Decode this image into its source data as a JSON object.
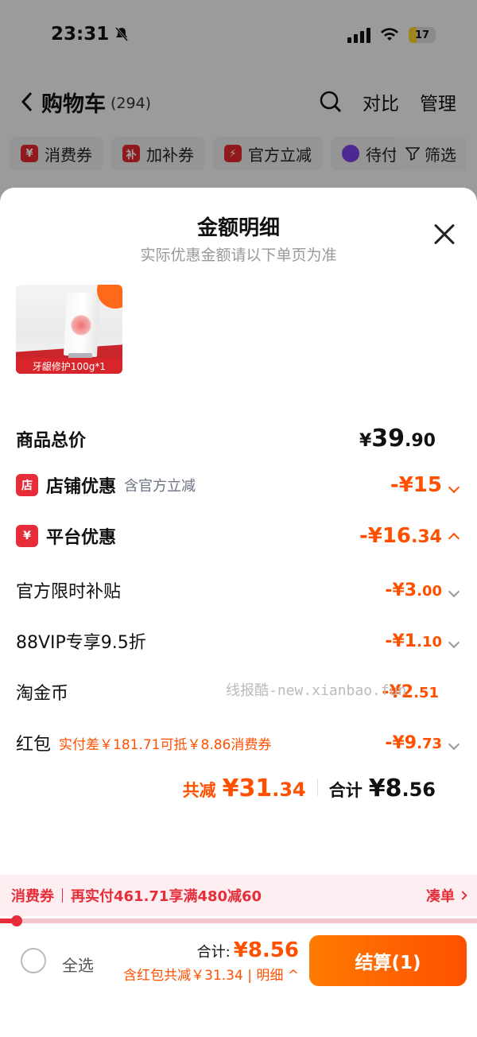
{
  "status_bar": {
    "time": "23:31",
    "battery": "17"
  },
  "cart_header": {
    "title": "购物车",
    "count": "(294)",
    "compare": "对比",
    "manage": "管理"
  },
  "filter_chips": [
    {
      "icon": "¥",
      "label": "消费券"
    },
    {
      "icon": "补",
      "label": "加补券"
    },
    {
      "icon": "⚡",
      "label": "官方立减"
    },
    {
      "icon": "",
      "label": "待付"
    }
  ],
  "filter_button": "筛选",
  "sheet": {
    "title": "金额明细",
    "subtitle": "实际优惠金额请以下单页为准"
  },
  "product": {
    "label": "牙龈修护100g*1"
  },
  "price_rows": {
    "total": {
      "label": "商品总价",
      "currency": "¥",
      "int": "39",
      "dec": ".90"
    },
    "shop": {
      "label": "店铺优惠",
      "note": "含官方立减",
      "value": "-¥15"
    },
    "platform": {
      "label": "平台优惠",
      "value_int": "-¥16",
      "value_dec": ".34"
    },
    "subsidy": {
      "label": "官方限时补贴",
      "value_int": "-¥3",
      "value_dec": ".00"
    },
    "vip": {
      "label": "88VIP专享9.5折",
      "value_int": "-¥1",
      "value_dec": ".10"
    },
    "coins": {
      "label": "淘金币",
      "value_int": "-¥2",
      "value_dec": ".51"
    },
    "redpacket": {
      "label": "红包",
      "note": "实付差￥181.71可抵￥8.86消费券",
      "value_int": "-¥9",
      "value_dec": ".73"
    }
  },
  "watermark": "线报酷-new.xianbao.fun",
  "totals": {
    "saved_label": "共减",
    "saved_int": "¥31",
    "saved_dec": ".34",
    "total_label": "合计",
    "total_int": "¥8",
    "total_dec": ".56"
  },
  "coupon_bar": {
    "tag": "消费券",
    "message": "再实付461.71享满480减60",
    "action": "凑单"
  },
  "coupon_progress": 0.03,
  "footer": {
    "select_all": "全选",
    "sum_label": "合计:",
    "sum_value": "¥8.56",
    "detail": "含红包共减￥31.34 | 明细",
    "checkout": "结算(1)"
  },
  "colors": {
    "accent": "#ff5000",
    "red": "#e62e3b"
  }
}
